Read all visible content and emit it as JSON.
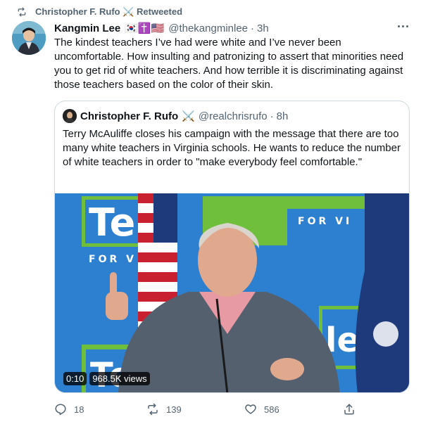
{
  "retweet": {
    "label": "Christopher F. Rufo ⚔️ Retweeted"
  },
  "tweet": {
    "name": "Kangmin Lee",
    "flags": "🇰🇷✝️🇺🇸",
    "handle": "@thekangminlee",
    "time": "3h",
    "text": "The kindest teachers I’ve had were white and I’ve never been uncomfortable. How insulting and patronizing to assert that minorities need you to get rid of white teachers. And how terrible it is discriminating against those teachers based on the color of their skin."
  },
  "quote": {
    "name": "Christopher F. Rufo",
    "swords": "⚔️",
    "handle": "@realchrisrufo",
    "time": "8h",
    "text": "Terry McAuliffe closes his campaign with the message that there are too many white teachers in Virginia schools. He wants to reduce the number of white teachers in order to \"make everybody feel comfortable.\"",
    "video": {
      "duration": "0:10",
      "views": "968.5K views",
      "sign_main": "Terry",
      "sign_sub": "FOR VIRGINIA",
      "sign_left_sub": "FOR V   NI"
    }
  },
  "actions": {
    "replies": "18",
    "retweets": "139",
    "likes": "586"
  },
  "icons": {
    "retweet": "retweet-icon",
    "reply": "reply-icon",
    "like": "heart-icon",
    "share": "share-icon",
    "more": "more-icon"
  },
  "colors": {
    "text": "#0f1419",
    "secondary": "#536471",
    "border": "#cfd9de",
    "sign_blue": "#2d7fd0",
    "sign_green": "#6fbf3c"
  }
}
